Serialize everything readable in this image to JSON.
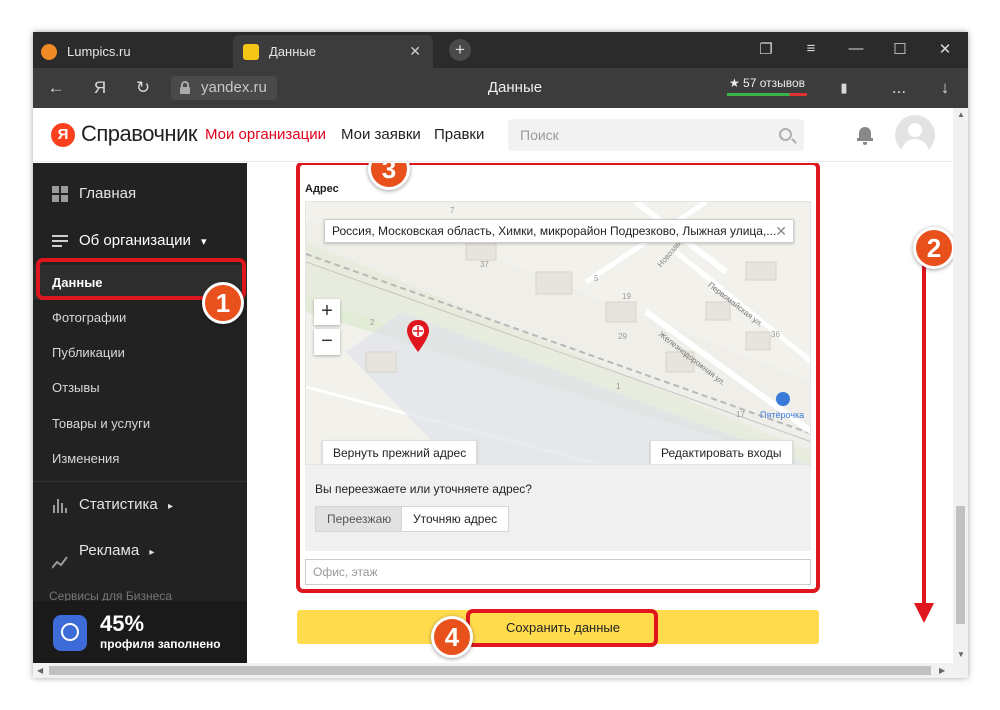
{
  "browser": {
    "tabs": [
      {
        "label": "Lumpics.ru"
      },
      {
        "label": "Данные"
      }
    ],
    "new_tab": "+",
    "nav": {
      "back": "←",
      "yandex": "Я",
      "reload": "↻",
      "url": "yandex.ru",
      "page_title": "Данные",
      "reviews": "★ 57 отзывов",
      "bookmark": "▮",
      "more": "...",
      "download": "↓"
    },
    "window_controls": {
      "collections": "❐",
      "menu": "≡",
      "minimize": "—",
      "maximize": "☐",
      "close": "✕"
    }
  },
  "site": {
    "logo_letter": "Я",
    "logo_text": "Справочник",
    "nav": [
      "Мои организации",
      "Мои заявки",
      "Правки"
    ],
    "search_placeholder": "Поиск"
  },
  "sidebar": {
    "home": "Главная",
    "about": "Об организации",
    "sub_items": [
      "Данные",
      "Фотографии",
      "Публикации",
      "Отзывы",
      "Товары и услуги",
      "Изменения"
    ],
    "statistics": "Статистика",
    "ads": "Реклама",
    "services": "Сервисы для Бизнеса",
    "progress_percent": "45%",
    "progress_text": "профиля заполнено",
    "dropdown_arrow": "▾",
    "expand_arrow": "▸"
  },
  "address": {
    "label": "Адрес",
    "value": "Россия, Московская область, Химки, микрорайон Подрезково, Лыжная улица,...",
    "clear": "✕",
    "zoom_in": "+",
    "zoom_out": "−",
    "restore_button": "Вернуть прежний адрес",
    "edit_entrances_button": "Редактировать входы",
    "move_question": "Вы переезжаете или уточняете адрес?",
    "options": [
      "Переезжаю",
      "Уточняю адрес"
    ],
    "office_placeholder": "Офис, этаж"
  },
  "map_labels": {
    "street1": "Новозаводская",
    "street2": "Первомайская ул.",
    "street3": "Железнодорожная ул.",
    "store": "Пятёрочка",
    "numbers": [
      "7",
      "37",
      "5",
      "19",
      "2",
      "29",
      "36",
      "17",
      "1"
    ]
  },
  "save_button": "Сохранить данные",
  "badges": [
    "1",
    "2",
    "3",
    "4"
  ],
  "colors": {
    "accent_red": "#e0161f",
    "badge_orange": "#e8501c",
    "save_yellow": "#ffdb4d",
    "sidebar_bg": "#222222",
    "nav_active": "#e0001b"
  }
}
